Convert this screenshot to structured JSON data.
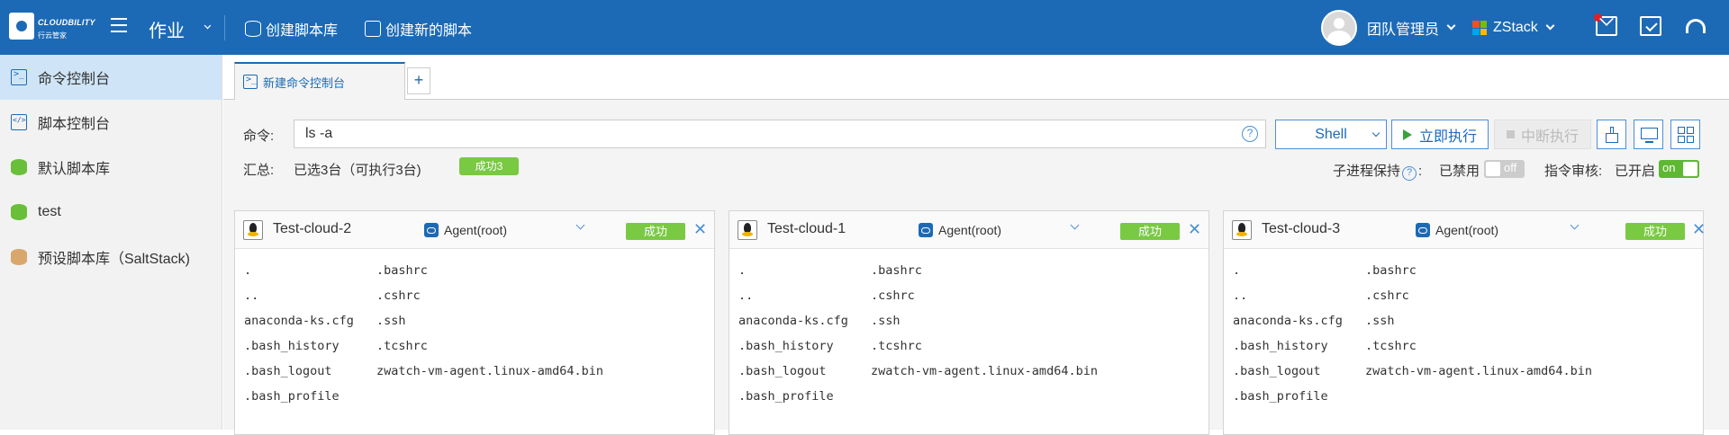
{
  "topbar": {
    "logo_line1": "CLOUDBILITY",
    "logo_line2": "行云管家",
    "nav_title": "作业",
    "create_library": "创建脚本库",
    "create_script": "创建新的脚本",
    "user_name": "团队管理员",
    "cloud_name": "ZStack"
  },
  "sidebar": {
    "items": [
      {
        "label": "命令控制台",
        "icon": "terminal-icon"
      },
      {
        "label": "脚本控制台",
        "icon": "script-icon"
      },
      {
        "label": "默认脚本库",
        "icon": "database-icon"
      },
      {
        "label": "test",
        "icon": "database-icon"
      },
      {
        "label": "预设脚本库（SaltStack)",
        "icon": "database-icon"
      }
    ]
  },
  "tabs": {
    "active": "新建命令控制台",
    "add": "+"
  },
  "command": {
    "label": "命令:",
    "value": "ls -a",
    "help": "?",
    "shell": "Shell",
    "run": "立即执行",
    "stop": "中断执行"
  },
  "summary": {
    "label": "汇总:",
    "text": "已选3台（可执行3台)",
    "badge": "成功3",
    "subprocess_label": "子进程保持",
    "subprocess_status": "已禁用",
    "subprocess_toggle": "off",
    "audit_label": "指令审核:",
    "audit_status": "已开启",
    "audit_toggle": "on"
  },
  "panels": [
    {
      "name": "Test-cloud-2",
      "agent": "Agent(root)",
      "status": "成功",
      "output": [
        [
          ".",
          ".bashrc"
        ],
        [
          "..",
          ".cshrc"
        ],
        [
          "anaconda-ks.cfg",
          ".ssh"
        ],
        [
          ".bash_history",
          ".tcshrc"
        ],
        [
          ".bash_logout",
          "zwatch-vm-agent.linux-amd64.bin"
        ],
        [
          ".bash_profile",
          ""
        ]
      ]
    },
    {
      "name": "Test-cloud-1",
      "agent": "Agent(root)",
      "status": "成功",
      "output": [
        [
          ".",
          ".bashrc"
        ],
        [
          "..",
          ".cshrc"
        ],
        [
          "anaconda-ks.cfg",
          ".ssh"
        ],
        [
          ".bash_history",
          ".tcshrc"
        ],
        [
          ".bash_logout",
          "zwatch-vm-agent.linux-amd64.bin"
        ],
        [
          ".bash_profile",
          ""
        ]
      ]
    },
    {
      "name": "Test-cloud-3",
      "agent": "Agent(root)",
      "status": "成功",
      "output": [
        [
          ".",
          ".bashrc"
        ],
        [
          "..",
          ".cshrc"
        ],
        [
          "anaconda-ks.cfg",
          ".ssh"
        ],
        [
          ".bash_history",
          ".tcshrc"
        ],
        [
          ".bash_logout",
          "zwatch-vm-agent.linux-amd64.bin"
        ],
        [
          ".bash_profile",
          ""
        ]
      ]
    }
  ],
  "colors": {
    "brand": "#1c6ab6",
    "success": "#7ac943",
    "sidebar_active": "#cfe5f7"
  }
}
